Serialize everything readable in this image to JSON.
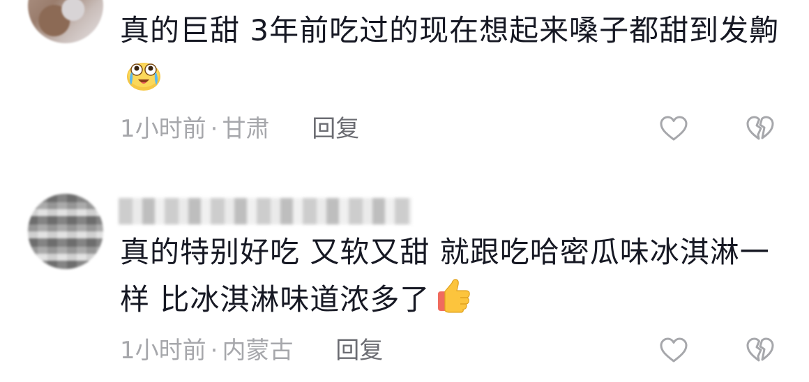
{
  "comments": [
    {
      "username": "",
      "text": "真的巨甜 3年前吃过的现在想起来嗓子都甜到发齁",
      "emoji": "crying-laughing-emoji",
      "time": "1小时前",
      "separator": "·",
      "location": "甘肃",
      "reply_label": "回复",
      "like_icon": "heart-outline-icon",
      "dislike_icon": "broken-heart-outline-icon"
    },
    {
      "username": "",
      "text": "真的特别好吃 又软又甜 就跟吃哈密瓜味冰淇淋一样 比冰淇淋味道浓多了",
      "emoji": "thumbs-up-emoji",
      "time": "1小时前",
      "separator": "·",
      "location": "内蒙古",
      "reply_label": "回复",
      "like_icon": "heart-outline-icon",
      "dislike_icon": "broken-heart-outline-icon"
    }
  ],
  "colors": {
    "text": "#161823",
    "meta": "#a6a7ab",
    "reply": "#6b6c72",
    "icon": "#a6a7ab"
  }
}
